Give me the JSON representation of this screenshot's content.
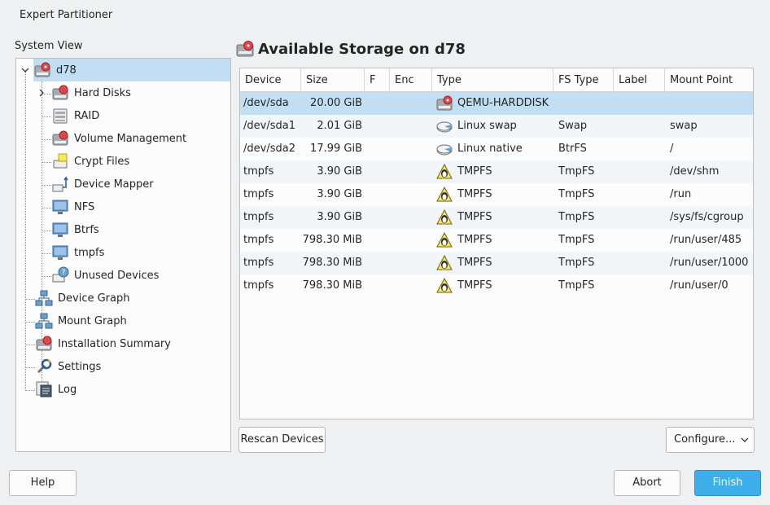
{
  "window": {
    "title": "Expert Partitioner"
  },
  "system_view": {
    "label": "System View",
    "root": {
      "label": "d78",
      "icon": "harddisk-icon"
    },
    "children": [
      {
        "label": "Hard Disks",
        "icon": "harddisk-icon"
      },
      {
        "label": "RAID",
        "icon": "raid-icon"
      },
      {
        "label": "Volume Management",
        "icon": "volume-icon"
      },
      {
        "label": "Crypt Files",
        "icon": "crypt-files-icon"
      },
      {
        "label": "Device Mapper",
        "icon": "device-mapper-icon"
      },
      {
        "label": "NFS",
        "icon": "nfs-icon"
      },
      {
        "label": "Btrfs",
        "icon": "btrfs-icon"
      },
      {
        "label": "tmpfs",
        "icon": "tmpfs-icon"
      },
      {
        "label": "Unused Devices",
        "icon": "unused-devices-icon"
      }
    ],
    "top_items": [
      {
        "label": "Device Graph",
        "icon": "device-graph-icon"
      },
      {
        "label": "Mount Graph",
        "icon": "mount-graph-icon"
      },
      {
        "label": "Installation Summary",
        "icon": "installation-summary-icon"
      },
      {
        "label": "Settings",
        "icon": "settings-icon"
      },
      {
        "label": "Log",
        "icon": "log-icon"
      }
    ]
  },
  "storage": {
    "title": "Available Storage on d78",
    "columns": [
      "Device",
      "Size",
      "F",
      "Enc",
      "Type",
      "FS Type",
      "Label",
      "Mount Point"
    ],
    "rows": [
      {
        "device": "/dev/sda",
        "size": "20.00 GiB",
        "type": "QEMU-HARDDISK",
        "type_icon": "harddisk",
        "fs_type": "",
        "label": "",
        "mount": ""
      },
      {
        "device": "/dev/sda1",
        "size": "2.01 GiB",
        "type": "Linux swap",
        "type_icon": "partition",
        "fs_type": "Swap",
        "label": "",
        "mount": "swap"
      },
      {
        "device": "/dev/sda2",
        "size": "17.99 GiB",
        "type": "Linux native",
        "type_icon": "partition",
        "fs_type": "BtrFS",
        "label": "",
        "mount": "/"
      },
      {
        "device": "tmpfs",
        "size": "3.90 GiB",
        "type": "TMPFS",
        "type_icon": "tux",
        "fs_type": "TmpFS",
        "label": "",
        "mount": "/dev/shm"
      },
      {
        "device": "tmpfs",
        "size": "3.90 GiB",
        "type": "TMPFS",
        "type_icon": "tux",
        "fs_type": "TmpFS",
        "label": "",
        "mount": "/run"
      },
      {
        "device": "tmpfs",
        "size": "3.90 GiB",
        "type": "TMPFS",
        "type_icon": "tux",
        "fs_type": "TmpFS",
        "label": "",
        "mount": "/sys/fs/cgroup"
      },
      {
        "device": "tmpfs",
        "size": "798.30 MiB",
        "type": "TMPFS",
        "type_icon": "tux",
        "fs_type": "TmpFS",
        "label": "",
        "mount": "/run/user/485"
      },
      {
        "device": "tmpfs",
        "size": "798.30 MiB",
        "type": "TMPFS",
        "type_icon": "tux",
        "fs_type": "TmpFS",
        "label": "",
        "mount": "/run/user/1000"
      },
      {
        "device": "tmpfs",
        "size": "798.30 MiB",
        "type": "TMPFS",
        "type_icon": "tux",
        "fs_type": "TmpFS",
        "label": "",
        "mount": "/run/user/0"
      }
    ]
  },
  "buttons": {
    "rescan": "Rescan Devices",
    "configure": "Configure...",
    "help": "Help",
    "abort": "Abort",
    "finish": "Finish"
  },
  "colors": {
    "accent": "#3daee9",
    "selection": "#c2def3",
    "window_bg": "#eff0f1"
  }
}
